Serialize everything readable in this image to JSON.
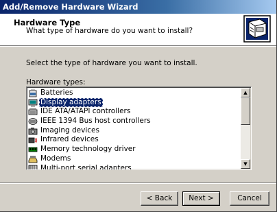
{
  "window": {
    "title": "Add/Remove Hardware Wizard"
  },
  "header": {
    "title": "Hardware Type",
    "subtitle": "What type of hardware do you want to install?",
    "icon": "hardware-wizard-icon"
  },
  "main": {
    "instruction": "Select the type of hardware you want to install.",
    "list_label": "Hardware types:",
    "items": [
      {
        "label": "Batteries",
        "icon": "battery-icon",
        "selected": false
      },
      {
        "label": "Display adapters",
        "icon": "monitor-icon",
        "selected": true
      },
      {
        "label": "IDE ATA/ATAPI controllers",
        "icon": "ide-controller-icon",
        "selected": false
      },
      {
        "label": "IEEE 1394 Bus host controllers",
        "icon": "ieee1394-icon",
        "selected": false
      },
      {
        "label": "Imaging devices",
        "icon": "camera-icon",
        "selected": false
      },
      {
        "label": "Infrared devices",
        "icon": "infrared-icon",
        "selected": false
      },
      {
        "label": "Memory technology driver",
        "icon": "memory-icon",
        "selected": false
      },
      {
        "label": "Modems",
        "icon": "modem-icon",
        "selected": false
      },
      {
        "label": "Multi-port serial adapters",
        "icon": "serial-port-icon",
        "selected": false
      }
    ]
  },
  "footer": {
    "back_label": "< Back",
    "next_label": "Next >",
    "cancel_label": "Cancel"
  },
  "colors": {
    "titlebar_start": "#0a246a",
    "titlebar_end": "#a6caf0",
    "face": "#d4d0c8",
    "selection": "#0a246a"
  }
}
